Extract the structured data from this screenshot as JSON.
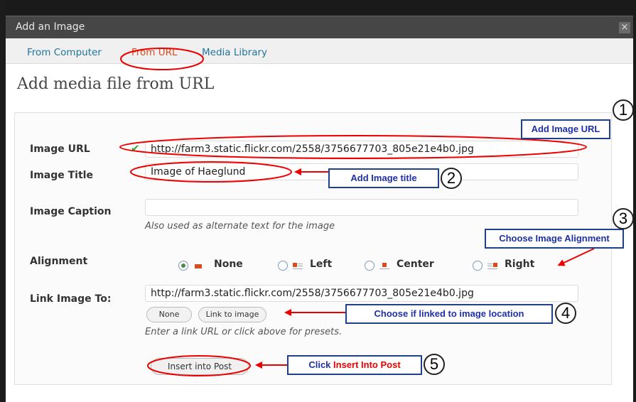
{
  "dialog": {
    "title": "Add an Image",
    "close": "×"
  },
  "tabs": [
    {
      "label": "From Computer"
    },
    {
      "label": "From URL"
    },
    {
      "label": "Media Library"
    }
  ],
  "heading": "Add media file from URL",
  "form": {
    "image_url": {
      "label": "Image URL",
      "value": "http://farm3.static.flickr.com/2558/3756677703_805e21e4b0.jpg"
    },
    "image_title": {
      "label": "Image Title",
      "value": "Image of Haeglund"
    },
    "image_caption": {
      "label": "Image Caption",
      "value": "",
      "help": "Also used as alternate text for the image"
    },
    "alignment": {
      "label": "Alignment",
      "options": [
        "None",
        "Left",
        "Center",
        "Right"
      ],
      "selected": "None"
    },
    "link_to": {
      "label": "Link Image To:",
      "value": "http://farm3.static.flickr.com/2558/3756677703_805e21e4b0.jpg",
      "buttons": [
        "None",
        "Link to image"
      ],
      "help": "Enter a link URL or click above for presets."
    },
    "submit_label": "Insert into Post"
  },
  "annotations": [
    {
      "num": "1",
      "text": "Add Image URL"
    },
    {
      "num": "2",
      "text": "Add Image title"
    },
    {
      "num": "3",
      "text": "Choose Image Alignment"
    },
    {
      "num": "4",
      "text": "Choose if linked to image location"
    },
    {
      "num": "5",
      "text_prefix": "Click ",
      "text_highlight": "Insert Into Post"
    }
  ],
  "colors": {
    "link": "#21759b",
    "active_tab": "#d54e21",
    "annotation_red": "#e00000",
    "callout_blue": "#1f2fa8"
  }
}
